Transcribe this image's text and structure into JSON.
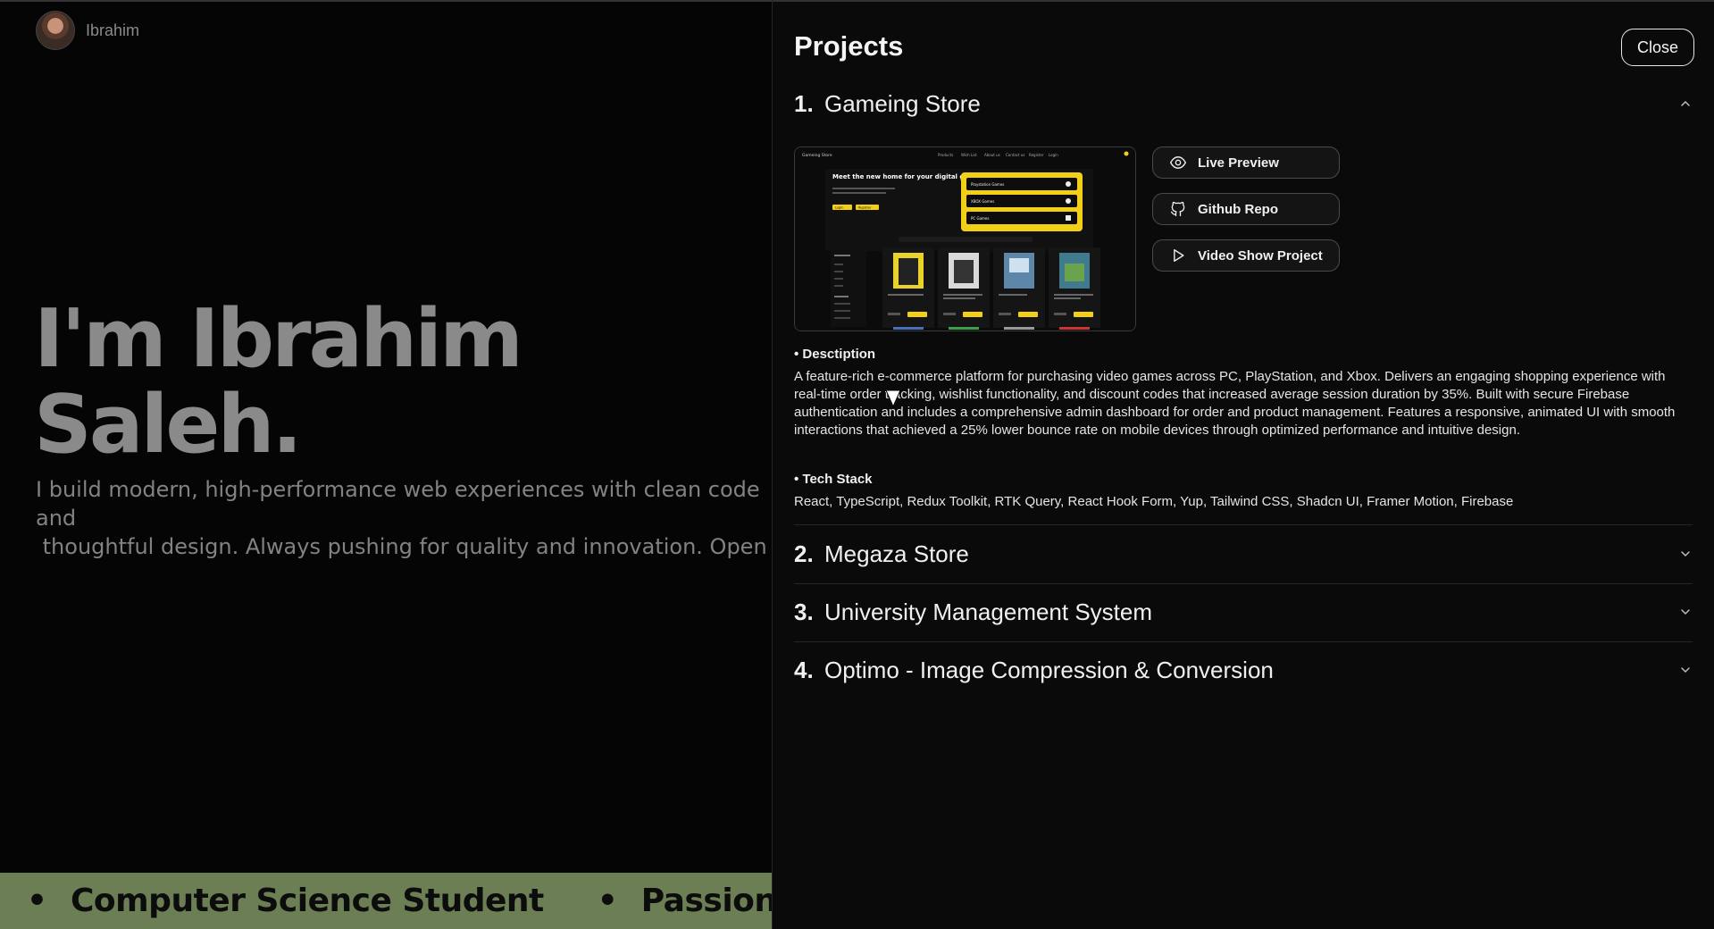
{
  "hero": {
    "brand_name": "Ibrahim",
    "title_line1": "I'm Ibrahim",
    "title_line2": "Saleh.",
    "subtitle": "I build modern, high-performance web experiences with clean code and\n thoughtful design. Always pushing for quality and innovation. Open to\nnew opportunities.",
    "ticker": [
      "Computer Science Student",
      "Passionate"
    ]
  },
  "drawer": {
    "title": "Projects",
    "close_label": "Close",
    "projects": [
      {
        "num": "1.",
        "title": "Gameing Store",
        "expanded": true,
        "actions": [
          "Live Preview",
          "Github Repo",
          "Video Show Project"
        ],
        "description_label": "• Desctiption",
        "description": "A feature-rich e-commerce platform for purchasing video games across PC, PlayStation, and Xbox. Delivers an engaging shopping experience with real-time order tracking, wishlist functionality, and discount codes that increased average session duration by 35%. Built with secure Firebase authentication and includes a comprehensive admin dashboard for order and product management. Features a responsive, animated UI with smooth interactions that achieved a 25% lower bounce rate on mobile devices through optimized performance and intuitive design.",
        "tech_label": "• Tech Stack",
        "tech": "React, TypeScript, Redux Toolkit, RTK Query, React Hook Form, Yup, Tailwind CSS, Shadcn UI, Framer Motion, Firebase",
        "preview": {
          "logo": "Gameing Store",
          "nav": [
            "Products",
            "Wish List",
            "About us",
            "Contact us",
            "Register",
            "Login"
          ],
          "headline": "Meet the new home for your digital games",
          "platforms": [
            "Playstation Games",
            "XBOX Games",
            "PC Games"
          ],
          "buttons": [
            "Login",
            "Register"
          ]
        }
      },
      {
        "num": "2.",
        "title": "Megaza Store",
        "expanded": false
      },
      {
        "num": "3.",
        "title": "University Management System",
        "expanded": false
      },
      {
        "num": "4.",
        "title": "Optimo - Image Compression & Conversion",
        "expanded": false
      }
    ]
  },
  "colors": {
    "ticker_bg": "#6b7e54",
    "preview_accent": "#f2d016",
    "hero_text": "#8a8a8a"
  },
  "icons": {
    "live_preview": "eye-icon",
    "github": "github-icon",
    "video": "play-icon",
    "chevron_up": "chevron-up-icon",
    "chevron_down": "chevron-down-icon"
  }
}
